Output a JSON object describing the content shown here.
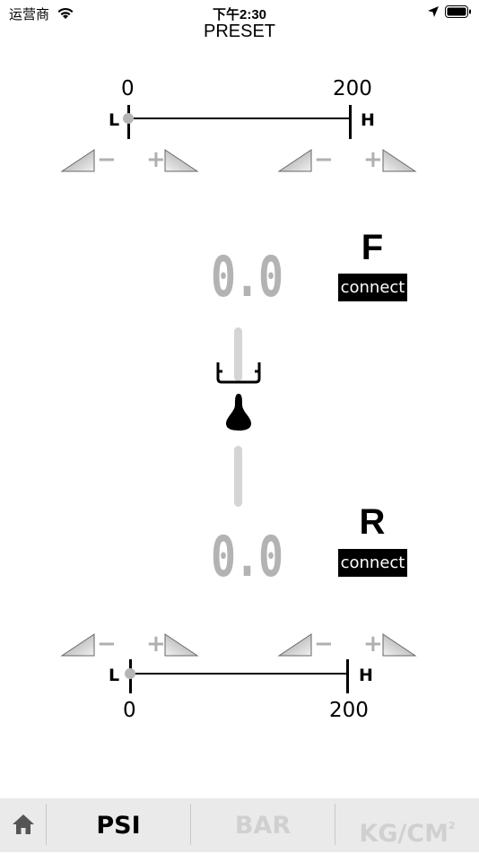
{
  "status_bar": {
    "carrier": "运营商",
    "time": "下午2:30"
  },
  "header": {
    "title": "PRESET"
  },
  "front_scale": {
    "min_label": "0",
    "max_label": "200",
    "low_label": "L",
    "high_label": "H",
    "value_fraction": 0
  },
  "rear_scale": {
    "min_label": "0",
    "max_label": "200",
    "low_label": "L",
    "high_label": "H",
    "value_fraction": 0
  },
  "adjusters": {
    "minus": "−",
    "plus": "+"
  },
  "front": {
    "letter": "F",
    "reading": "0.0",
    "connect_label": "connect"
  },
  "rear": {
    "letter": "R",
    "reading": "0.0",
    "connect_label": "connect"
  },
  "tabs": [
    {
      "label": "PSI",
      "active": true
    },
    {
      "label": "BAR",
      "active": false
    },
    {
      "label": "KG/CM",
      "sup": "2",
      "active": false
    }
  ],
  "colors": {
    "active_tab": "#000000",
    "inactive_tab": "#d0d0d0",
    "reading": "#b3b3b3",
    "tab_bg": "#eaeaea"
  }
}
